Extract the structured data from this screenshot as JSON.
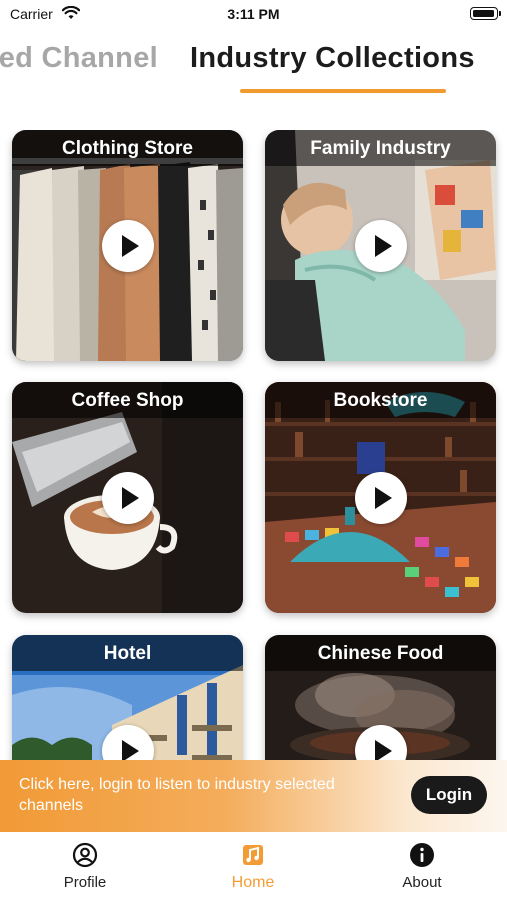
{
  "status_bar": {
    "carrier": "Carrier",
    "time": "3:11 PM"
  },
  "tabs": [
    {
      "label": "Selected Channel",
      "visible_text": "ed Channel",
      "active": false
    },
    {
      "label": "Industry Collections",
      "active": true
    }
  ],
  "colors": {
    "accent": "#f09a2f",
    "login_button": "#1a1a1a",
    "banner_start": "#f19a36"
  },
  "collections": [
    {
      "title": "Clothing Store",
      "icon": "play-icon"
    },
    {
      "title": "Family Industry",
      "icon": "play-icon"
    },
    {
      "title": "Coffee Shop",
      "icon": "play-icon"
    },
    {
      "title": "Bookstore",
      "icon": "play-icon"
    },
    {
      "title": "Hotel",
      "icon": "play-icon"
    },
    {
      "title": "Chinese Food",
      "icon": "play-icon"
    }
  ],
  "banner": {
    "message": "Click here, login to listen to industry selected channels",
    "login_label": "Login"
  },
  "bottom_nav": [
    {
      "label": "Profile",
      "icon": "person-circle-icon",
      "active": false
    },
    {
      "label": "Home",
      "icon": "music-note-icon",
      "active": true
    },
    {
      "label": "About",
      "icon": "info-icon",
      "active": false
    }
  ]
}
